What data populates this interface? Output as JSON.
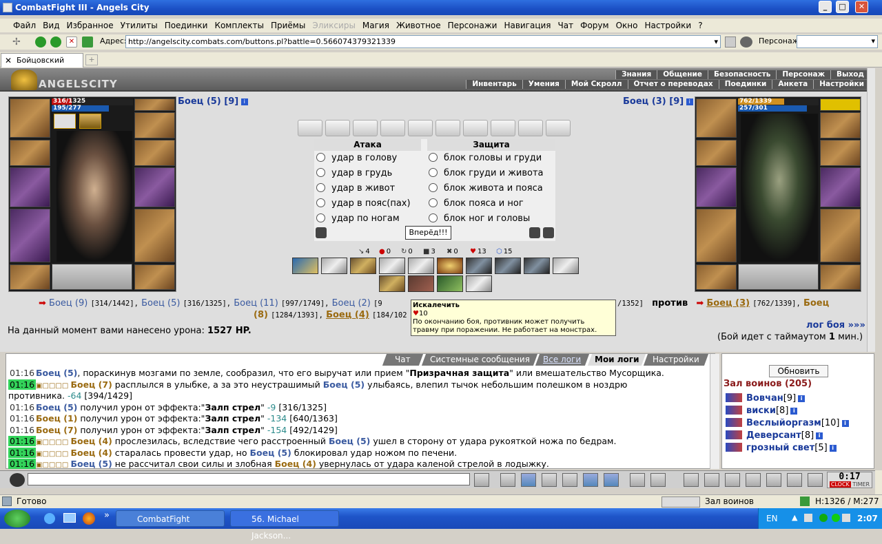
{
  "window": {
    "title": "CombatFight III - Angels City"
  },
  "menu": [
    "Файл",
    "Вид",
    "Избранное",
    "Утилиты",
    "Поединки",
    "Комплекты",
    "Приёмы",
    "Эликсиры",
    "Магия",
    "Животное",
    "Персонажи",
    "Навигация",
    "Чат",
    "Форум",
    "Окно",
    "Настройки",
    "?"
  ],
  "address": {
    "label": "Адрес:",
    "url": "http://angelscity.combats.com/buttons.pl?battle=0.566074379321339",
    "persona_label": "Персонаж:"
  },
  "tab": {
    "label": "Бойцовский клуб"
  },
  "game": {
    "logo": "ANGELSCITY",
    "nav_top": [
      "Знания",
      "Общение",
      "Безопасность",
      "Персонаж",
      "Выход"
    ],
    "nav_bottom": [
      "Инвентарь",
      "Умения",
      "Мой Скролл",
      "Отчет о переводах",
      "Поединки",
      "Анкета",
      "Настройки"
    ],
    "left_fighter": {
      "name": "Боец (5) [9]",
      "hp": "316/1325",
      "mana": "195/277"
    },
    "right_fighter": {
      "name": "Боец (3) [9]",
      "hp": "762/1339",
      "mana": "257/301"
    },
    "attack": {
      "header": "Атака",
      "options": [
        "удар в голову",
        "удар в грудь",
        "удар в живот",
        "удар в пояс(пах)",
        "удар по ногам"
      ]
    },
    "defense": {
      "header": "Защита",
      "options": [
        "блок головы и груди",
        "блок груди и живота",
        "блок живота и пояса",
        "блок пояса и ног",
        "блок ног и головы"
      ]
    },
    "go_button": "Вперёд!!!",
    "stats": [
      "4",
      "0",
      "0",
      "3",
      "0",
      "13",
      "15"
    ],
    "tooltip": {
      "title": "Искалечить",
      "value": "10",
      "text1": "По окончанию боя, противник может получить",
      "text2": "травму при поражении. Не работает на монстрах."
    },
    "teams": {
      "left1": [
        {
          "n": "Боец (9)",
          "hp": "[314/1442],"
        },
        {
          "n": "Боец (5)",
          "hp": "[316/1325],"
        },
        {
          "n": "Боец (11)",
          "hp": "[997/1749],"
        },
        {
          "n": "Боец (2)",
          "hp": "[9"
        }
      ],
      "left2": [
        {
          "n": "(8)",
          "hp": "[1284/1393],"
        },
        {
          "n": "Боец (4)",
          "hp": "[184/102"
        }
      ],
      "hidden_tail": "/1352]",
      "vs": "против",
      "right1": {
        "n": "Боец (3)",
        "hp": "[762/1339],"
      },
      "right1b": "Боец"
    },
    "damage": {
      "label": "На данный момент вами нанесено урона:",
      "value": "1527 HP."
    },
    "log_link": "лог боя »»»",
    "timeout": {
      "pre": "(Бой идет с таймаутом",
      "val": "1",
      "post": "мин.)"
    }
  },
  "chat_tabs": [
    "Чат",
    "Системные сообщения",
    "Все логи",
    "Мои логи",
    "Настройки"
  ],
  "chat": [
    {
      "t": "01:16",
      "a": "Боец (5)",
      "b": ", пораскинув мозгами по земле, сообразил, что его выручат или прием \"",
      "c": "Призрачная защита",
      "d": "\" или вмешательство Мусорщика."
    },
    {
      "t": "01:16",
      "a": "Боец (7)",
      "b": " расплылся в улыбке, а за это неустрашимый ",
      "c": "Боец (5)",
      "d": " улыбаясь, влепил тычок небольшим полешком в ноздрю"
    },
    {
      "cont": "противника. ",
      "dmg": "-64",
      "hp": " [394/1429]"
    },
    {
      "t": "01:16",
      "a": "Боец (5)",
      "b": " получил урон от эффекта:\"",
      "c": "Залп стрел",
      "d": "\" ",
      "dmg": "-9",
      "hp": " [316/1325]"
    },
    {
      "t": "01:16",
      "a": "Боец (1)",
      "b": " получил урон от эффекта:\"",
      "c": "Залп стрел",
      "d": "\" ",
      "dmg": "-134",
      "hp": " [640/1363]"
    },
    {
      "t": "01:16",
      "a": "Боец (7)",
      "b": " получил урон от эффекта:\"",
      "c": "Залп стрел",
      "d": "\" ",
      "dmg": "-154",
      "hp": " [492/1429]"
    },
    {
      "t": "01:16",
      "a": "Боец (4)",
      "b": " прослезилась, вследствие чего расстроенный ",
      "c": "Боец (5)",
      "d": " ушел в сторону от удара рукояткой ножа по бедрам."
    },
    {
      "t": "01:16",
      "a": "Боец (4)",
      "b": " старалась провести удар, но ",
      "c": "Боец (5)",
      "d": " блокировал удар ножом по печени."
    },
    {
      "t": "01:16",
      "a": "Боец (5)",
      "b": " не рассчитал свои силы и злобная ",
      "c": "Боец (4)",
      "d": " увернулась от удара каленой стрелой в лодыжку."
    }
  ],
  "side": {
    "refresh": "Обновить",
    "hall": "Зал воинов (205)",
    "players": [
      {
        "n": "Вовчан",
        "l": "[9]"
      },
      {
        "n": "виски",
        "l": "[8]"
      },
      {
        "n": "Веслыйоргазм",
        "l": "[10]"
      },
      {
        "n": "Деверсант",
        "l": "[8]"
      },
      {
        "n": "грозный свет",
        "l": "[5]"
      }
    ]
  },
  "clock": {
    "time": "0:17",
    "clock_label": "CLOCK",
    "timer_label": "TIMER"
  },
  "status": {
    "ready": "Готово",
    "hall": "Зал воинов",
    "hm": "H:1326 / M:277"
  },
  "taskbar": {
    "items": [
      "CombatFight",
      "56. Michael Jackson..."
    ],
    "lang": "EN",
    "time": "2:07"
  }
}
